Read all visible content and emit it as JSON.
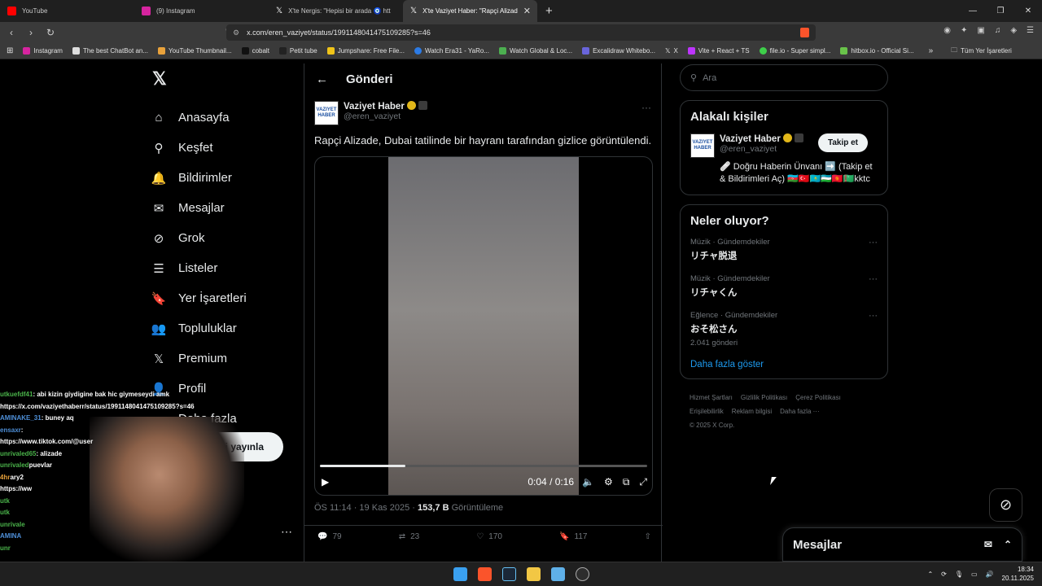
{
  "browser": {
    "tabs": [
      {
        "title": "YouTube",
        "color": "#ff0000"
      },
      {
        "title": "(9) Instagram",
        "color": "#d6249f"
      },
      {
        "title": "X'te Nergis: \"Hepisi bir arada 🧿 htt",
        "color": "#ffffff"
      },
      {
        "title": "X'te Vaziyet Haber: \"Rapçi Alizad",
        "color": "#ffffff"
      }
    ],
    "url": "x.com/eren_vaziyet/status/1991148041475109285?s=46",
    "bookmarks": [
      "Instagram",
      "The best ChatBot an...",
      "YouTube Thumbnail...",
      "cobalt",
      "Petit tube",
      "Jumpshare: Free File...",
      "Watch Era31 - YaRo...",
      "Watch Global & Loc...",
      "Excalidraw Whitebo...",
      "X",
      "Vite + React + TS",
      "file.io - Super simpl...",
      "hitbox.io - Official Si..."
    ],
    "bookmarks_folder": "Tüm Yer İşaretleri"
  },
  "sidebar": {
    "logo": "𝕏",
    "items": [
      {
        "label": "Anasayfa",
        "icon": "home-icon",
        "glyph": "⌂"
      },
      {
        "label": "Keşfet",
        "icon": "search-icon",
        "glyph": "⚲"
      },
      {
        "label": "Bildirimler",
        "icon": "bell-icon",
        "glyph": "🔔"
      },
      {
        "label": "Mesajlar",
        "icon": "mail-icon",
        "glyph": "✉"
      },
      {
        "label": "Grok",
        "icon": "grok-icon",
        "glyph": "⊘"
      },
      {
        "label": "Listeler",
        "icon": "list-icon",
        "glyph": "☰"
      },
      {
        "label": "Yer İşaretleri",
        "icon": "bookmark-icon",
        "glyph": "🔖"
      },
      {
        "label": "Topluluklar",
        "icon": "communities-icon",
        "glyph": "👥"
      },
      {
        "label": "Premium",
        "icon": "x-premium-icon",
        "glyph": "𝕏"
      },
      {
        "label": "Profil",
        "icon": "profile-icon",
        "glyph": "👤"
      },
      {
        "label": "Daha fazla",
        "icon": "more-circle-icon",
        "glyph": "⋯"
      }
    ],
    "post_button": "Gönderi yayınla"
  },
  "post": {
    "header": "Gönderi",
    "author_name": "Vaziyet Haber",
    "author_handle": "@eren_vaziyet",
    "avatar_text": "VAZIYET HABER",
    "text": "Rapçi Alizade, Dubai tatilinde bir hayranı tarafından gizlice görüntülendi.",
    "video_time": "0:04 / 0:16",
    "video_progress": 0.26,
    "timestamp": "ÖS 11:14 · 19 Kas 2025 · ",
    "views": "153,7 B",
    "views_label": " Görüntüleme",
    "replies": "79",
    "reposts": "23",
    "likes": "170",
    "bookmarks": "117"
  },
  "right": {
    "search_placeholder": "Ara",
    "related_title": "Alakalı kişiler",
    "related_name": "Vaziyet Haber",
    "related_handle": "@eren_vaziyet",
    "follow_label": "Takip et",
    "related_bio": "🩹 Doğru Haberin Ünvanı ➡️ (Takip et & Bildirimleri Aç) 🇦🇿🇹🇷🇰🇿🇺🇿🇰🇬🇹🇲kktc",
    "trending_title": "Neler oluyor?",
    "trends": [
      {
        "category": "Müzik · Gündemdekiler",
        "title": "リチャ脱退",
        "count": ""
      },
      {
        "category": "Müzik · Gündemdekiler",
        "title": "リチャくん",
        "count": ""
      },
      {
        "category": "Eğlence · Gündemdekiler",
        "title": "おそ松さん",
        "count": "2.041 gönderi"
      }
    ],
    "show_more": "Daha fazla göster",
    "footer_links": [
      "Hizmet Şartları",
      "Gizlilik Politikası",
      "Çerez Politikası",
      "Erişilebilirlik",
      "Reklam bilgisi",
      "Daha fazla ···"
    ],
    "copyright": "© 2025 X Corp."
  },
  "messages_dock": "Mesajlar",
  "chat": [
    {
      "user": "utkuefdf41",
      "msg": ": abi kizin giydigine bak hic giymeseydi amk"
    },
    {
      "user": "",
      "msg": "https://x.com/vaziyethaberr/status/1991148041475109285?s=46"
    },
    {
      "user": "AMINAKE_31",
      "msg": ": buney aq"
    },
    {
      "user": "ensaxr",
      "msg": ":"
    },
    {
      "user": "",
      "msg": "https://www.tiktok.com/@user"
    },
    {
      "user": "unrivaled65",
      "msg": ": alizade"
    },
    {
      "user": "unrivaled",
      "msg": "puevlar"
    },
    {
      "user": "4hr",
      "msg": "ary2"
    },
    {
      "user": "",
      "msg": "https://ww"
    },
    {
      "user": "utk",
      "msg": ""
    },
    {
      "user": "utk",
      "msg": ""
    },
    {
      "user": "unrivale",
      "msg": ""
    },
    {
      "user": "AMINA",
      "msg": ""
    },
    {
      "user": "unr",
      "msg": ""
    },
    {
      "user": "u",
      "msg": ""
    }
  ],
  "taskbar": {
    "time": "18:34",
    "date": "20.11.2025"
  }
}
